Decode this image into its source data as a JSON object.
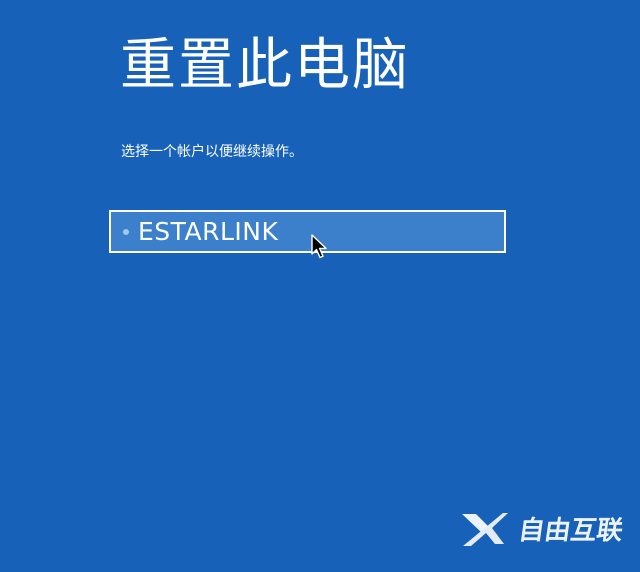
{
  "screen": {
    "title": "重置此电脑",
    "instruction": "选择一个帐户以便继续操作。"
  },
  "accounts": [
    {
      "label": "ESTARLINK"
    }
  ],
  "watermark": {
    "text": "自由互联",
    "icon": "x-logo-icon"
  },
  "colors": {
    "background": "#1761b8",
    "selected_item": "#3c80cc",
    "text": "#ffffff"
  },
  "icons": {
    "bullet": "bullet-dot-icon",
    "cursor": "mouse-pointer-icon"
  }
}
